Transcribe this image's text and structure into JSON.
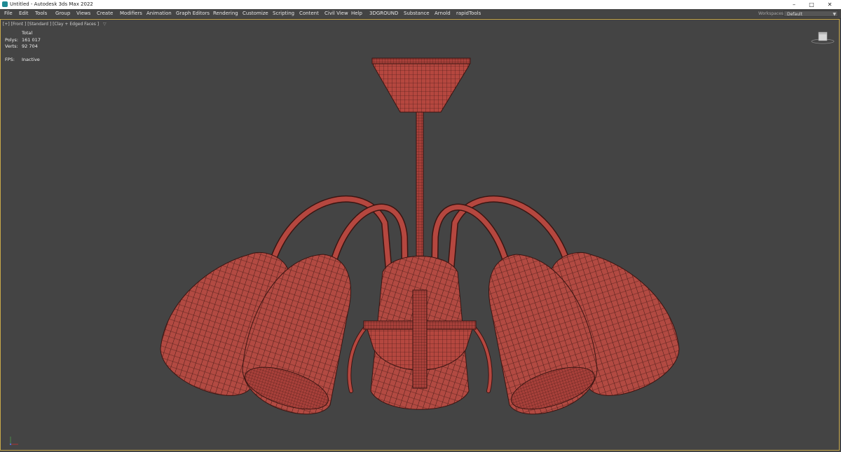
{
  "window": {
    "title": "Untitled - Autodesk 3ds Max 2022",
    "app_icon": "3dsmax-icon",
    "controls": {
      "minimize": "–",
      "restore": "□",
      "close": "✕"
    }
  },
  "menubar": {
    "items": [
      "File",
      "Edit",
      "Tools",
      "Group",
      "Views",
      "Create",
      "Modifiers",
      "Animation",
      "Graph Editors",
      "Rendering",
      "Customize",
      "Scripting",
      "Content",
      "Civil View",
      "Help",
      "3DGROUND",
      "Substance",
      "Arnold",
      "rapidTools"
    ],
    "workspaces_label": "Workspaces:",
    "workspaces_value": "Default"
  },
  "viewport": {
    "label": "[+] [Front ] [Standard ] [Clay + Edged Faces ]",
    "filter_icon": "funnel-icon",
    "stats": {
      "header": "Total",
      "polys_label": "Polys:",
      "polys_value": "161 017",
      "verts_label": "Verts:",
      "verts_value": "92 704",
      "fps_label": "FPS:",
      "fps_value": "Inactive"
    },
    "border_color": "#c8a94a",
    "background": "#444444",
    "model_color": "#b5473f",
    "wire_color": "#3a1512"
  }
}
